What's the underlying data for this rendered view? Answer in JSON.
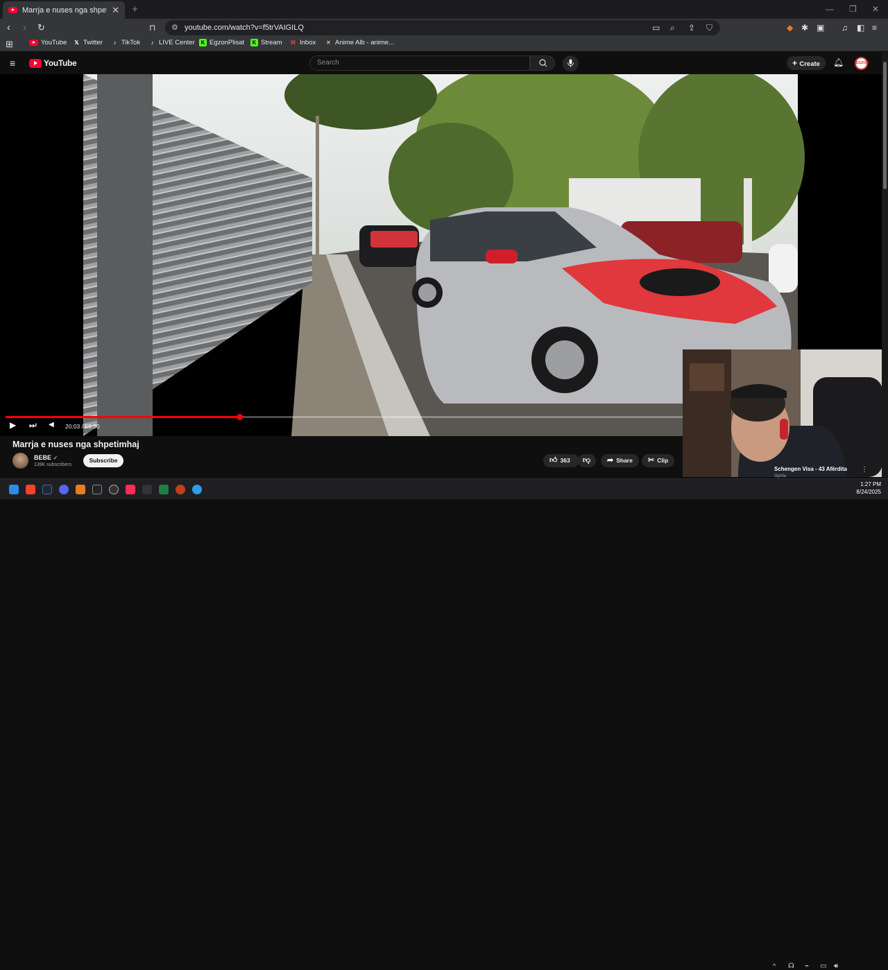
{
  "browser": {
    "tab_title": "Marrja e nuses nga shpetimhaj",
    "tab_close": "✕",
    "new_tab": "+",
    "url": "youtube.com/watch?v=f5trVAIGILQ",
    "bookmarks": [
      {
        "label": "YouTube",
        "icon": "youtube-icon",
        "color": "#ff0033"
      },
      {
        "label": "Twitter",
        "icon": "x-icon",
        "color": "#ffffff"
      },
      {
        "label": "TikTok",
        "icon": "tiktok-icon",
        "color": "#ffffff"
      },
      {
        "label": "LIVE Center",
        "icon": "tiktok-icon",
        "color": "#ffffff"
      },
      {
        "label": "EgzonPlisat",
        "icon": "kick-icon",
        "color": "#53fc18"
      },
      {
        "label": "Stream",
        "icon": "kick-icon",
        "color": "#53fc18"
      },
      {
        "label": "Inbox",
        "icon": "gmail-icon",
        "color": "#ea4335"
      },
      {
        "label": "Anime Alb - anime...",
        "icon": "anime-icon",
        "color": "#e0c070"
      }
    ]
  },
  "youtube": {
    "logo_text": "YouTube",
    "search_placeholder": "Search",
    "create_label": "Create",
    "avatar_text": "EGZON"
  },
  "player": {
    "time": "20:03 / 59:30",
    "progress_fraction": 0.3367
  },
  "video": {
    "title": "Marrja e nuses nga shpetimhaj",
    "channel_name": "BEBE",
    "subscribers": "139K subscribers",
    "subscribe_label": "Subscribe",
    "likes": "363",
    "share_label": "Share",
    "clip_label": "Clip"
  },
  "webcam": {
    "caption": "Schengen Visa - 43 Afërdita",
    "caption_sub": "Gjinfa"
  },
  "taskbar": {
    "time": "1:27 PM",
    "date": "8/24/2025"
  },
  "colors": {
    "accent_red": "#ff0000",
    "background": "#0f0f0f"
  }
}
